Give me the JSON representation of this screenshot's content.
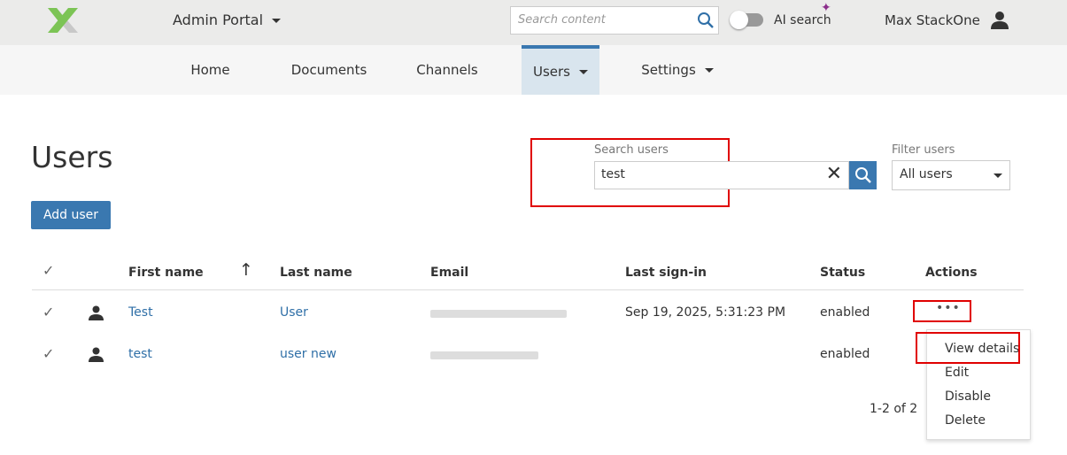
{
  "header": {
    "app_menu": "Admin Portal",
    "search_placeholder": "Search content",
    "ai_search_label": "AI search",
    "user_name": "Max StackOne"
  },
  "nav": {
    "items": [
      {
        "label": "Home"
      },
      {
        "label": "Documents"
      },
      {
        "label": "Channels"
      },
      {
        "label": "Users",
        "active": true
      },
      {
        "label": "Settings"
      }
    ]
  },
  "page": {
    "title": "Users",
    "add_user": "Add user",
    "search_label": "Search users",
    "search_value": "test",
    "filter_label": "Filter users",
    "filter_value": "All users"
  },
  "table": {
    "columns": [
      "First name",
      "Last name",
      "Email",
      "Last sign-in",
      "Status",
      "Actions"
    ],
    "rows": [
      {
        "first": "Test",
        "last": "User",
        "last_signin": "Sep 19, 2025, 5:31:23 PM",
        "status": "enabled"
      },
      {
        "first": "test",
        "last": "user new",
        "last_signin": "",
        "status": "enabled"
      }
    ],
    "pagination": "1-2 of 2"
  },
  "actions_menu": [
    "View details",
    "Edit",
    "Disable",
    "Delete"
  ],
  "colors": {
    "accent": "#3a78b0",
    "highlight": "#e00000"
  }
}
